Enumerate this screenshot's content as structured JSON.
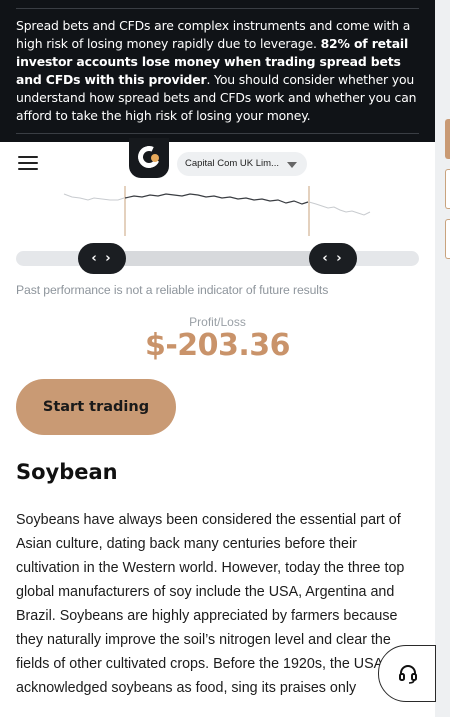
{
  "risk_warning": {
    "text_plain_1": "Spread bets and CFDs are complex instruments and come with a high risk of losing money rapidly due to leverage. ",
    "text_bold": "82% of retail investor accounts lose money when trading spread bets and CFDs with this provider",
    "text_plain_2": ". You should consider whether you understand how spread bets and CFDs work and whether you can afford to take the high risk of losing your money."
  },
  "header": {
    "entity_selector": "Capital Com UK Lim...",
    "logo_icon": "capital-com-logo"
  },
  "chart": {
    "left_handle": "‹ ›",
    "right_handle": "‹ ›",
    "disclaimer": "Past performance is not a reliable indicator of future results"
  },
  "profit_loss": {
    "label": "Profit/Loss",
    "value": "$-203.36"
  },
  "cta": {
    "start_trading": "Start trading"
  },
  "article": {
    "heading": "Soybean",
    "body": "Soybeans have always been considered the essential part of Asian culture, dating back many centuries before their cultivation in the Western world. However, today the three top global manufacturers of soy include the USA, Argentina and Brazil. Soybeans are highly appreciated by farmers because they naturally improve the soil’s nitrogen level and clear the fields of other cultivated crops. Before the 1920s, the USA acknowledged soybeans as food, sing its praises only"
  },
  "colors": {
    "accent": "#c99a74",
    "banner_bg": "#101317",
    "profit_loss": "#c9936a"
  },
  "icons": {
    "menu": "hamburger-menu-icon",
    "dropdown": "caret-down-icon",
    "support": "headset-icon"
  }
}
